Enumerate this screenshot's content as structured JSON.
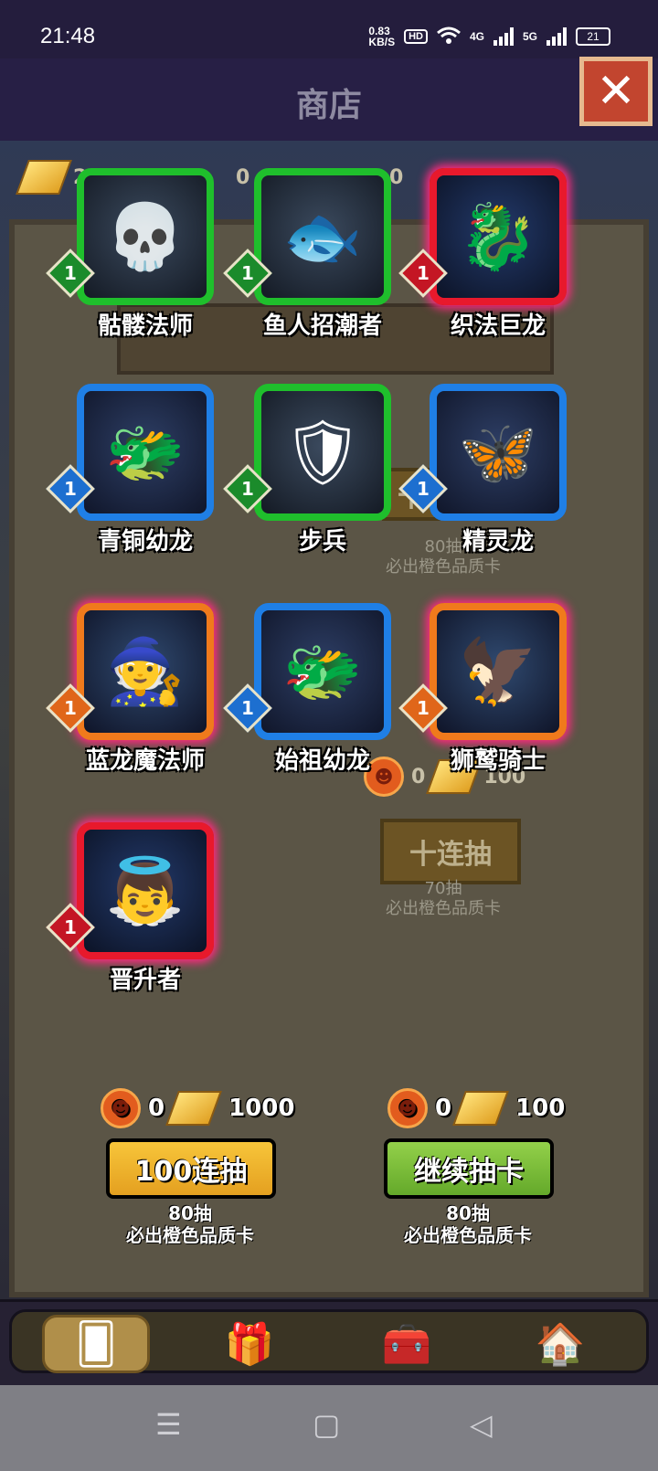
{
  "status": {
    "time": "21:48",
    "speed_value": "0.83",
    "speed_unit": "KB/S",
    "hd": "HD",
    "net1": "4G",
    "net2": "5G",
    "battery": "21"
  },
  "header": {
    "title": "商店",
    "close_icon": "close-x-icon"
  },
  "bg_currency": {
    "left_value": "2",
    "mid_value": "0",
    "right_value": "0"
  },
  "bg_drawers": [
    {
      "count": "80抽",
      "note": "必出橙色品质卡",
      "btn": "十"
    },
    {
      "btn": "十连抽",
      "count": "70抽",
      "note": "必出橙色品质卡",
      "c1": "0",
      "c2": "100"
    }
  ],
  "cards": [
    {
      "name": "骷髅法师",
      "level": "1",
      "rarity": "green",
      "icon": "skeleton-mage-icon",
      "glyph": "💀"
    },
    {
      "name": "鱼人招潮者",
      "level": "1",
      "rarity": "green",
      "icon": "murloc-tidecaller-icon",
      "glyph": "🐟"
    },
    {
      "name": "织法巨龙",
      "level": "1",
      "rarity": "red",
      "icon": "spellweaver-dragon-icon",
      "glyph": "🐉"
    },
    {
      "name": "青铜幼龙",
      "level": "1",
      "rarity": "blue",
      "icon": "bronze-whelp-icon",
      "glyph": "🐲"
    },
    {
      "name": "步兵",
      "level": "1",
      "rarity": "green",
      "icon": "footman-icon",
      "glyph": "🛡"
    },
    {
      "name": "精灵龙",
      "level": "1",
      "rarity": "blue",
      "icon": "faerie-dragon-icon",
      "glyph": "🦋"
    },
    {
      "name": "蓝龙魔法师",
      "level": "1",
      "rarity": "orange",
      "icon": "blue-dragon-mage-icon",
      "glyph": "🧙"
    },
    {
      "name": "始祖幼龙",
      "level": "1",
      "rarity": "blue",
      "icon": "primal-whelp-icon",
      "glyph": "🐲"
    },
    {
      "name": "狮鹫骑士",
      "level": "1",
      "rarity": "orange",
      "icon": "gryphon-rider-icon",
      "glyph": "🦅"
    },
    {
      "name": "晋升者",
      "level": "1",
      "rarity": "red",
      "icon": "ascendant-icon",
      "glyph": "👼"
    }
  ],
  "draw_left": {
    "coin": "0",
    "gold": "1000",
    "button": "100连抽",
    "count": "80抽",
    "note": "必出橙色品质卡"
  },
  "draw_right": {
    "coin": "0",
    "gold": "100",
    "button": "继续抽卡",
    "count": "80抽",
    "note": "必出橙色品质卡"
  },
  "tabs": [
    {
      "icon": "card-pack-icon",
      "glyph": "🂠"
    },
    {
      "icon": "gift-box-icon",
      "glyph": "🎁"
    },
    {
      "icon": "treasure-chest-icon",
      "glyph": "🧰"
    },
    {
      "icon": "shop-house-icon",
      "glyph": "🏠"
    }
  ],
  "navbar": {
    "menu": "☰",
    "home": "▢",
    "back": "◁"
  },
  "colors": {
    "green": "#1fbf2c",
    "blue": "#1f7fe6",
    "red": "#e8192c",
    "orange": "#f07a1c",
    "glow": "#ff2a80"
  }
}
